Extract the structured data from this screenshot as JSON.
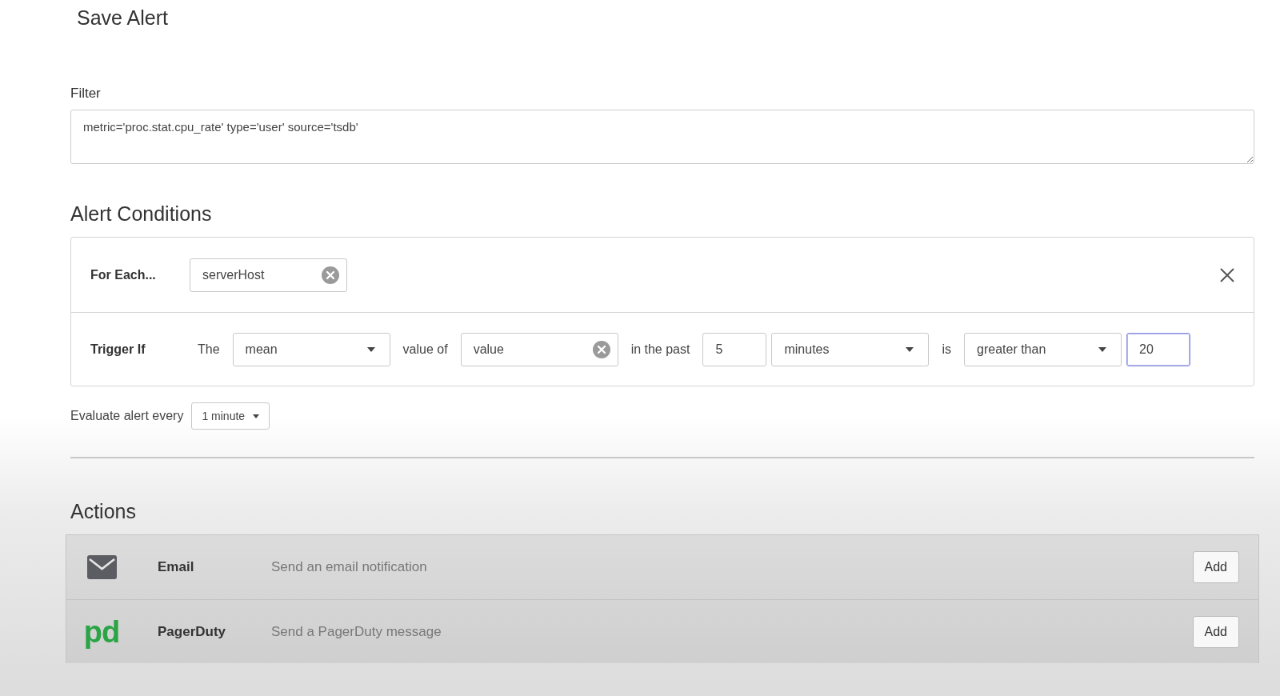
{
  "title": "Save Alert",
  "filter": {
    "label": "Filter",
    "value": "metric='proc.stat.cpu_rate' type='user' source='tsdb'"
  },
  "alert_conditions": {
    "heading": "Alert Conditions",
    "for_each": {
      "label": "For Each...",
      "tag": "serverHost"
    },
    "trigger_if": {
      "label": "Trigger If",
      "parts": [
        {
          "kind": "text",
          "text": "The"
        },
        {
          "kind": "select",
          "value": "mean"
        },
        {
          "kind": "text",
          "text": "value of"
        },
        {
          "kind": "tag",
          "value": "value"
        },
        {
          "kind": "text",
          "text": "in the past"
        },
        {
          "kind": "input",
          "value": "5",
          "focused": false
        },
        {
          "kind": "select",
          "value": "minutes"
        },
        {
          "kind": "text",
          "text": "is"
        },
        {
          "kind": "select",
          "value": "greater than"
        },
        {
          "kind": "input",
          "value": "20",
          "focused": true
        }
      ]
    }
  },
  "evaluate": {
    "label": "Evaluate alert every",
    "value": "1 minute"
  },
  "actions": {
    "heading": "Actions",
    "items": [
      {
        "kind": "email",
        "name": "Email",
        "description": "Send an email notification",
        "button": "Add"
      },
      {
        "kind": "pagerduty",
        "logo": "pd",
        "name": "PagerDuty",
        "description": "Send a PagerDuty message",
        "button": "Add"
      }
    ]
  }
}
